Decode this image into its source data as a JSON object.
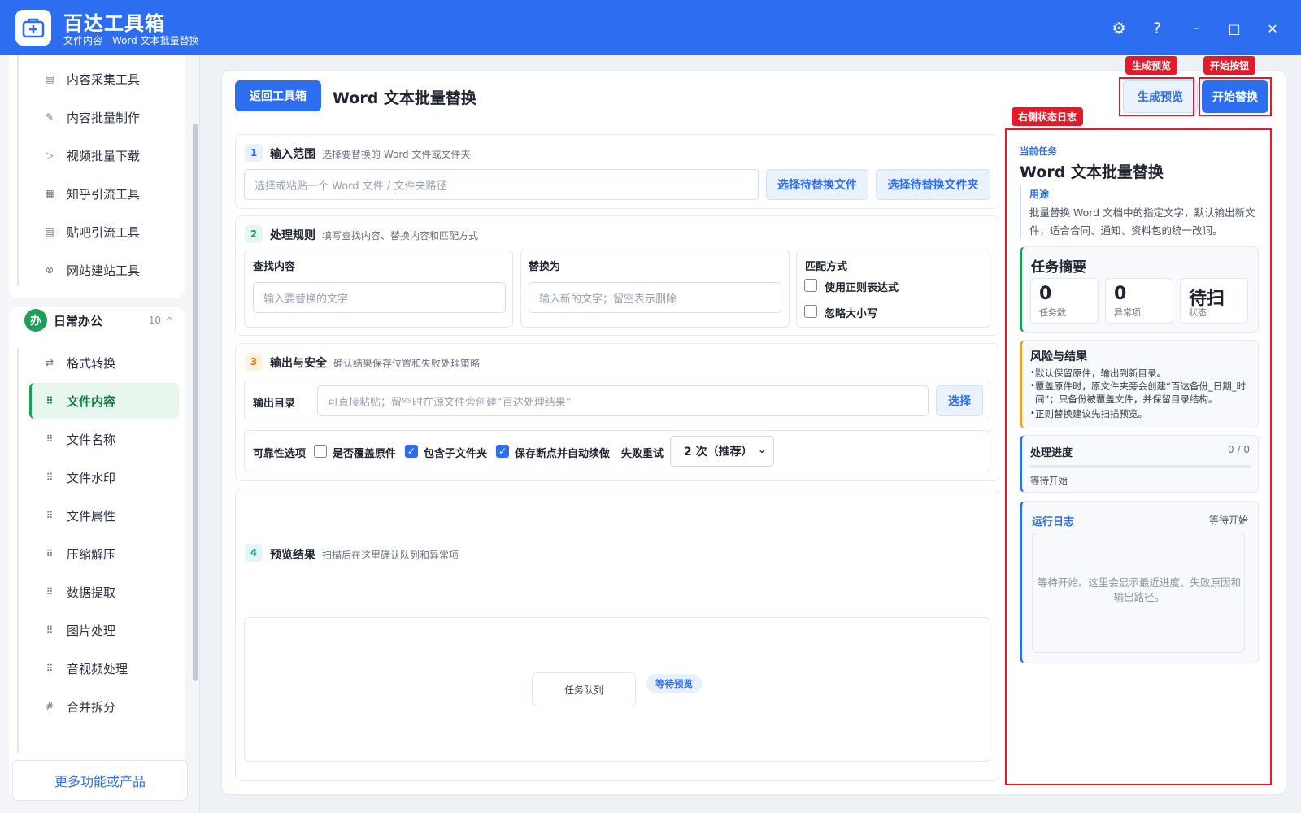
{
  "app": {
    "name": "百达工具箱",
    "subtitle": "文件内容 - Word 文本批量替换"
  },
  "window_controls": {
    "settings": "⚙",
    "help": "?",
    "minimize": "–",
    "maximize": "□",
    "close": "✕"
  },
  "sidebar": {
    "top_items": [
      {
        "label": "内容采集工具",
        "icon": "▤"
      },
      {
        "label": "内容批量制作",
        "icon": "✎"
      },
      {
        "label": "视频批量下载",
        "icon": "▷"
      },
      {
        "label": "知乎引流工具",
        "icon": "▦"
      },
      {
        "label": "贴吧引流工具",
        "icon": "▤"
      },
      {
        "label": "网站建站工具",
        "icon": "⊗"
      }
    ],
    "group": {
      "badge": "办",
      "name": "日常办公",
      "count": "10",
      "caret": "^"
    },
    "group_items": [
      {
        "label": "格式转换",
        "icon": "⇄"
      },
      {
        "label": "文件内容",
        "icon": "⠿",
        "active": true
      },
      {
        "label": "文件名称",
        "icon": "⠿"
      },
      {
        "label": "文件水印",
        "icon": "⠿"
      },
      {
        "label": "文件属性",
        "icon": "⠿"
      },
      {
        "label": "压缩解压",
        "icon": "⠿"
      },
      {
        "label": "数据提取",
        "icon": "⠿"
      },
      {
        "label": "图片处理",
        "icon": "⠿"
      },
      {
        "label": "音视频处理",
        "icon": "⠿"
      },
      {
        "label": "合并拆分",
        "icon": "#"
      }
    ],
    "more_button": "更多功能或产品"
  },
  "header": {
    "back_button": "返回工具箱",
    "title": "Word 文本批量替换",
    "preview_button": "生成预览",
    "start_button": "开始替换"
  },
  "annotations": {
    "preview": "生成预览",
    "start": "开始按钮",
    "right_log": "右侧状态日志"
  },
  "sections": {
    "input": {
      "step": "1",
      "title": "输入范围",
      "desc": "选择要替换的 Word 文件或文件夹",
      "path_placeholder": "选择或粘贴一个 Word 文件 / 文件夹路径",
      "choose_file": "选择待替换文件",
      "choose_folder": "选择待替换文件夹"
    },
    "rules": {
      "step": "2",
      "title": "处理规则",
      "desc": "填写查找内容、替换内容和匹配方式",
      "find_label": "查找内容",
      "find_placeholder": "输入要替换的文字",
      "replace_label": "替换为",
      "replace_placeholder": "输入新的文字；留空表示删除",
      "match_label": "匹配方式",
      "regex_label": "使用正则表达式",
      "regex_checked": false,
      "ignore_case_label": "忽略大小写",
      "ignore_case_checked": false
    },
    "output": {
      "step": "3",
      "title": "输出与安全",
      "desc": "确认结果保存位置和失败处理策略",
      "dir_label": "输出目录",
      "dir_placeholder": "可直接粘贴；留空时在源文件旁创建“百达处理结果”",
      "dir_button": "选择",
      "reliability_label": "可靠性选项",
      "overwrite_label": "是否覆盖原件",
      "overwrite_checked": false,
      "subfolder_label": "包含子文件夹",
      "subfolder_checked": true,
      "resume_label": "保存断点并自动续做",
      "resume_checked": true,
      "retry_label": "失败重试",
      "retry_value": "2 次（推荐）"
    },
    "preview": {
      "step": "4",
      "title": "预览结果",
      "desc": "扫描后在这里确认队列和异常项",
      "queue_label": "任务队列",
      "queue_status": "等待预览"
    }
  },
  "right_panel": {
    "current_task_label": "当前任务",
    "task_title": "Word 文本批量替换",
    "usage_label": "用途",
    "usage_text": "批量替换 Word 文档中的指定文字，默认输出新文件，适合合同、通知、资料包的统一改词。",
    "summary": {
      "title": "任务摘要",
      "stats": [
        {
          "value": "0",
          "label": "任务数"
        },
        {
          "value": "0",
          "label": "异常项"
        },
        {
          "value": "待扫",
          "label": "状态"
        }
      ]
    },
    "risk": {
      "title": "风险与结果",
      "items": [
        "默认保留原件，输出到新目录。",
        "覆盖原件时，原文件夹旁会创建“百达备份_日期_时间”；只备份被覆盖文件，并保留目录结构。",
        "正则替换建议先扫描预览。"
      ]
    },
    "progress": {
      "title": "处理进度",
      "count": "0 / 0",
      "value": 0,
      "status": "等待开始"
    },
    "log": {
      "title": "运行日志",
      "status": "等待开始",
      "placeholder": "等待开始。这里会显示最近进度、失败原因和输出路径。"
    }
  },
  "colors": {
    "brand": "#2d6ef0",
    "active_green": "#1f9d5a",
    "annotation_red": "#e01b2a"
  }
}
